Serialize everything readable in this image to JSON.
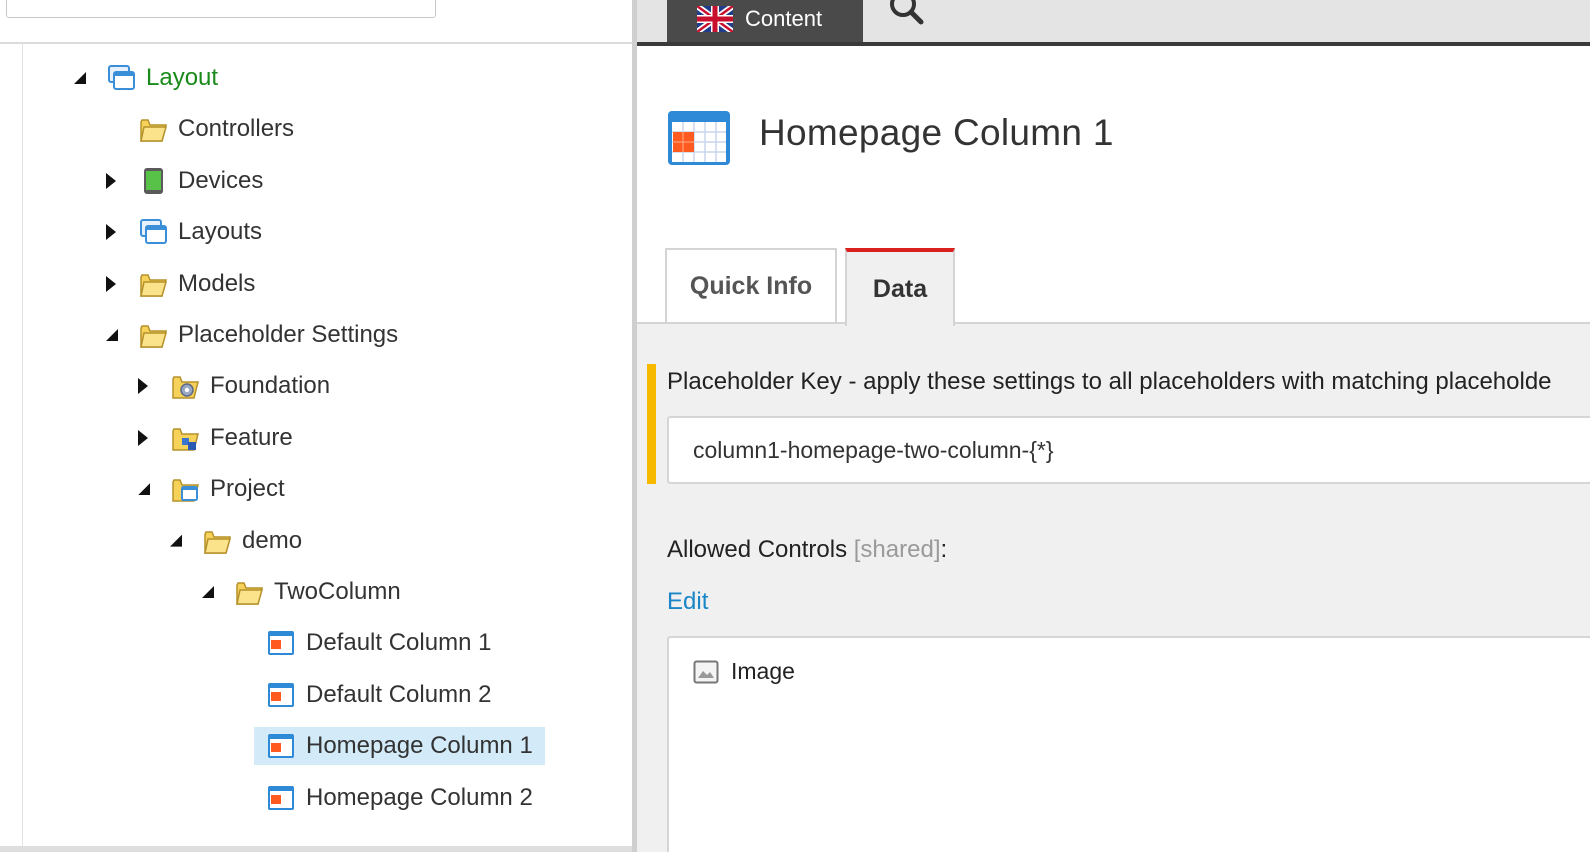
{
  "tree": {
    "items": [
      {
        "label": "Layout",
        "depth": 0,
        "expander": "expanded",
        "icon": "layout-icon",
        "style": "green"
      },
      {
        "label": "Controllers",
        "depth": 1,
        "expander": "none",
        "icon": "folder-icon"
      },
      {
        "label": "Devices",
        "depth": 1,
        "expander": "collapsed",
        "icon": "device-icon"
      },
      {
        "label": "Layouts",
        "depth": 1,
        "expander": "collapsed",
        "icon": "layout-icon"
      },
      {
        "label": "Models",
        "depth": 1,
        "expander": "collapsed",
        "icon": "folder-icon"
      },
      {
        "label": "Placeholder Settings",
        "depth": 1,
        "expander": "expanded",
        "icon": "folder-icon"
      },
      {
        "label": "Foundation",
        "depth": 2,
        "expander": "collapsed",
        "icon": "folder-gear-icon"
      },
      {
        "label": "Feature",
        "depth": 2,
        "expander": "collapsed",
        "icon": "folder-feature-icon"
      },
      {
        "label": "Project",
        "depth": 2,
        "expander": "expanded",
        "icon": "folder-layout-icon"
      },
      {
        "label": "demo",
        "depth": 3,
        "expander": "expanded",
        "icon": "folder-icon"
      },
      {
        "label": "TwoColumn",
        "depth": 4,
        "expander": "expanded",
        "icon": "folder-icon"
      },
      {
        "label": "Default Column 1",
        "depth": 5,
        "expander": "none",
        "icon": "placeholder-icon"
      },
      {
        "label": "Default Column 2",
        "depth": 5,
        "expander": "none",
        "icon": "placeholder-icon"
      },
      {
        "label": "Homepage Column 1",
        "depth": 5,
        "expander": "none",
        "icon": "placeholder-icon",
        "selected": true
      },
      {
        "label": "Homepage Column 2",
        "depth": 5,
        "expander": "none",
        "icon": "placeholder-icon"
      }
    ]
  },
  "editor": {
    "content_tab_label": "Content",
    "content_tab_icon": "uk-flag-icon",
    "search_icon": "search-icon",
    "item_title": "Homepage Column 1",
    "item_icon": "placeholder-icon",
    "tabs": [
      {
        "label": "Quick Info",
        "active": false
      },
      {
        "label": "Data",
        "active": true
      }
    ],
    "placeholder_key": {
      "label": "Placeholder Key - apply these settings to all placeholders with matching placeholde",
      "value": "column1-homepage-two-column-{*}"
    },
    "allowed_controls": {
      "label": "Allowed Controls",
      "shared_tag": "[shared]",
      "suffix": ":",
      "edit_label": "Edit",
      "items": [
        {
          "label": "Image",
          "icon": "image-icon"
        }
      ]
    }
  },
  "colors": {
    "selected_row": "#d3ebf8",
    "green_label": "#1a8a1a",
    "active_tab_accent": "#d9211f",
    "required_bar": "#f6b900",
    "link": "#1a86c7"
  }
}
